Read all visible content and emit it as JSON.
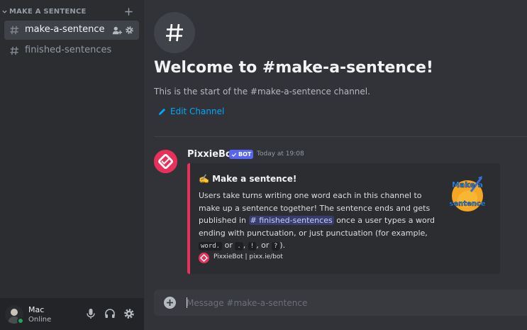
{
  "sidebar": {
    "category": "MAKE A SENTENCE",
    "channels": [
      {
        "name": "make-a-sentence",
        "active": true
      },
      {
        "name": "finished-sentences",
        "active": false
      }
    ]
  },
  "user": {
    "name": "Mac",
    "status": "Online"
  },
  "channel_header": {
    "welcome": "Welcome to #make-a-sentence!",
    "subtitle": "This is the start of the #make-a-sentence channel.",
    "edit_label": "Edit Channel"
  },
  "message": {
    "author": "PixxieBot",
    "tag": "BOT",
    "timestamp": "Today at 19:08",
    "embed": {
      "title": "✍️ Make a sentence!",
      "desc_part1": "Users take turns writing one word each in this channel to make up a sentence together! The sentence ends and gets published in ",
      "mention": "# finished-sentences",
      "desc_part2": " once a user types a word ending with punctuation, or just punctuation (for example, ",
      "code1": "word.",
      "or1": " or ",
      "code2": ".",
      "comma": ", ",
      "code3": "!",
      "or2": ", or ",
      "code4": "?",
      "end": ").",
      "thumbnail_text": [
        "Make a",
        "sentence"
      ],
      "footer": "PixxieBot | pixx.ie/bot"
    }
  },
  "composer": {
    "placeholder": "Message #make-a-sentence"
  },
  "colors": {
    "accent": "#5865f2",
    "brand_pink": "#e8315a",
    "link": "#00a8fc",
    "online": "#23a55a"
  },
  "icons": [
    "chevron-down-icon",
    "plus-icon",
    "hash-icon",
    "add-member-icon",
    "gear-icon",
    "mic-icon",
    "headphones-icon",
    "pencil-icon",
    "checkmark-icon"
  ]
}
